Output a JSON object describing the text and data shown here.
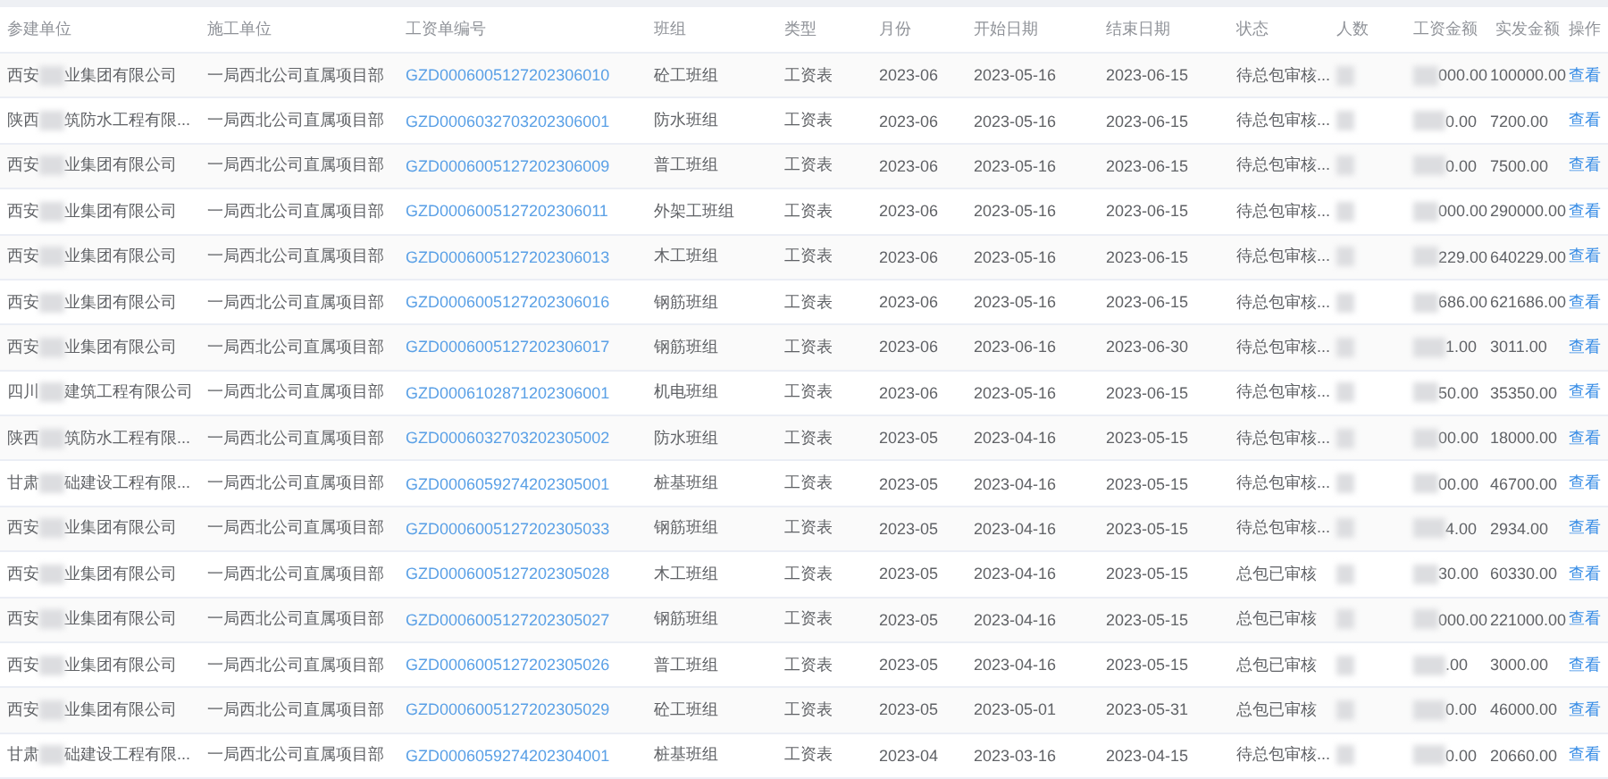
{
  "columns": [
    "参建单位",
    "施工单位",
    "工资单编号",
    "班组",
    "类型",
    "月份",
    "开始日期",
    "结束日期",
    "状态",
    "人数",
    "工资金额",
    "实发金额",
    "操作"
  ],
  "rows": [
    {
      "company_prefix": "西安",
      "company_suffix": "业集团有限公司",
      "contractor": "一局西北公司直属项目部",
      "code": "GZD0006005127202306010",
      "team": "砼工班组",
      "type": "工资表",
      "month": "2023-06",
      "start": "2023-05-16",
      "end": "2023-06-15",
      "status": "待总包审核...",
      "wage_suffix": "000.00",
      "paid": "100000.00",
      "action": "查看"
    },
    {
      "company_prefix": "陕西",
      "company_suffix": "筑防水工程有限...",
      "contractor": "一局西北公司直属项目部",
      "code": "GZD0006032703202306001",
      "team": "防水班组",
      "type": "工资表",
      "month": "2023-06",
      "start": "2023-05-16",
      "end": "2023-06-15",
      "status": "待总包审核...",
      "wage_suffix": "0.00",
      "paid": "7200.00",
      "action": "查看"
    },
    {
      "company_prefix": "西安",
      "company_suffix": "业集团有限公司",
      "contractor": "一局西北公司直属项目部",
      "code": "GZD0006005127202306009",
      "team": "普工班组",
      "type": "工资表",
      "month": "2023-06",
      "start": "2023-05-16",
      "end": "2023-06-15",
      "status": "待总包审核...",
      "wage_suffix": "0.00",
      "paid": "7500.00",
      "action": "查看"
    },
    {
      "company_prefix": "西安",
      "company_suffix": "业集团有限公司",
      "contractor": "一局西北公司直属项目部",
      "code": "GZD0006005127202306011",
      "team": "外架工班组",
      "type": "工资表",
      "month": "2023-06",
      "start": "2023-05-16",
      "end": "2023-06-15",
      "status": "待总包审核...",
      "wage_suffix": "000.00",
      "paid": "290000.00",
      "action": "查看"
    },
    {
      "company_prefix": "西安",
      "company_suffix": "业集团有限公司",
      "contractor": "一局西北公司直属项目部",
      "code": "GZD0006005127202306013",
      "team": "木工班组",
      "type": "工资表",
      "month": "2023-06",
      "start": "2023-05-16",
      "end": "2023-06-15",
      "status": "待总包审核...",
      "wage_suffix": "229.00",
      "paid": "640229.00",
      "action": "查看"
    },
    {
      "company_prefix": "西安",
      "company_suffix": "业集团有限公司",
      "contractor": "一局西北公司直属项目部",
      "code": "GZD0006005127202306016",
      "team": "钢筋班组",
      "type": "工资表",
      "month": "2023-06",
      "start": "2023-05-16",
      "end": "2023-06-15",
      "status": "待总包审核...",
      "wage_suffix": "686.00",
      "paid": "621686.00",
      "action": "查看"
    },
    {
      "company_prefix": "西安",
      "company_suffix": "业集团有限公司",
      "contractor": "一局西北公司直属项目部",
      "code": "GZD0006005127202306017",
      "team": "钢筋班组",
      "type": "工资表",
      "month": "2023-06",
      "start": "2023-06-16",
      "end": "2023-06-30",
      "status": "待总包审核...",
      "wage_suffix": "1.00",
      "paid": "3011.00",
      "action": "查看"
    },
    {
      "company_prefix": "四川",
      "company_suffix": "建筑工程有限公司",
      "contractor": "一局西北公司直属项目部",
      "code": "GZD0006102871202306001",
      "team": "机电班组",
      "type": "工资表",
      "month": "2023-06",
      "start": "2023-05-16",
      "end": "2023-06-15",
      "status": "待总包审核...",
      "wage_suffix": "50.00",
      "paid": "35350.00",
      "action": "查看"
    },
    {
      "company_prefix": "陕西",
      "company_suffix": "筑防水工程有限...",
      "contractor": "一局西北公司直属项目部",
      "code": "GZD0006032703202305002",
      "team": "防水班组",
      "type": "工资表",
      "month": "2023-05",
      "start": "2023-04-16",
      "end": "2023-05-15",
      "status": "待总包审核...",
      "wage_suffix": "00.00",
      "paid": "18000.00",
      "action": "查看"
    },
    {
      "company_prefix": "甘肃",
      "company_suffix": "础建设工程有限...",
      "contractor": "一局西北公司直属项目部",
      "code": "GZD0006059274202305001",
      "team": "桩基班组",
      "type": "工资表",
      "month": "2023-05",
      "start": "2023-04-16",
      "end": "2023-05-15",
      "status": "待总包审核...",
      "wage_suffix": "00.00",
      "paid": "46700.00",
      "action": "查看"
    },
    {
      "company_prefix": "西安",
      "company_suffix": "业集团有限公司",
      "contractor": "一局西北公司直属项目部",
      "code": "GZD0006005127202305033",
      "team": "钢筋班组",
      "type": "工资表",
      "month": "2023-05",
      "start": "2023-04-16",
      "end": "2023-05-15",
      "status": "待总包审核...",
      "wage_suffix": "4.00",
      "paid": "2934.00",
      "action": "查看"
    },
    {
      "company_prefix": "西安",
      "company_suffix": "业集团有限公司",
      "contractor": "一局西北公司直属项目部",
      "code": "GZD0006005127202305028",
      "team": "木工班组",
      "type": "工资表",
      "month": "2023-05",
      "start": "2023-04-16",
      "end": "2023-05-15",
      "status": "总包已审核",
      "wage_suffix": "30.00",
      "paid": "60330.00",
      "action": "查看"
    },
    {
      "company_prefix": "西安",
      "company_suffix": "业集团有限公司",
      "contractor": "一局西北公司直属项目部",
      "code": "GZD0006005127202305027",
      "team": "钢筋班组",
      "type": "工资表",
      "month": "2023-05",
      "start": "2023-04-16",
      "end": "2023-05-15",
      "status": "总包已审核",
      "wage_suffix": "000.00",
      "paid": "221000.00",
      "action": "查看"
    },
    {
      "company_prefix": "西安",
      "company_suffix": "业集团有限公司",
      "contractor": "一局西北公司直属项目部",
      "code": "GZD0006005127202305026",
      "team": "普工班组",
      "type": "工资表",
      "month": "2023-05",
      "start": "2023-04-16",
      "end": "2023-05-15",
      "status": "总包已审核",
      "wage_suffix": ".00",
      "paid": "3000.00",
      "action": "查看"
    },
    {
      "company_prefix": "西安",
      "company_suffix": "业集团有限公司",
      "contractor": "一局西北公司直属项目部",
      "code": "GZD0006005127202305029",
      "team": "砼工班组",
      "type": "工资表",
      "month": "2023-05",
      "start": "2023-05-01",
      "end": "2023-05-31",
      "status": "总包已审核",
      "wage_suffix": "0.00",
      "paid": "46000.00",
      "action": "查看"
    },
    {
      "company_prefix": "甘肃",
      "company_suffix": "础建设工程有限...",
      "contractor": "一局西北公司直属项目部",
      "code": "GZD0006059274202304001",
      "team": "桩基班组",
      "type": "工资表",
      "month": "2023-04",
      "start": "2023-03-16",
      "end": "2023-04-15",
      "status": "待总包审核...",
      "wage_suffix": "0.00",
      "paid": "20660.00",
      "action": "查看"
    }
  ]
}
